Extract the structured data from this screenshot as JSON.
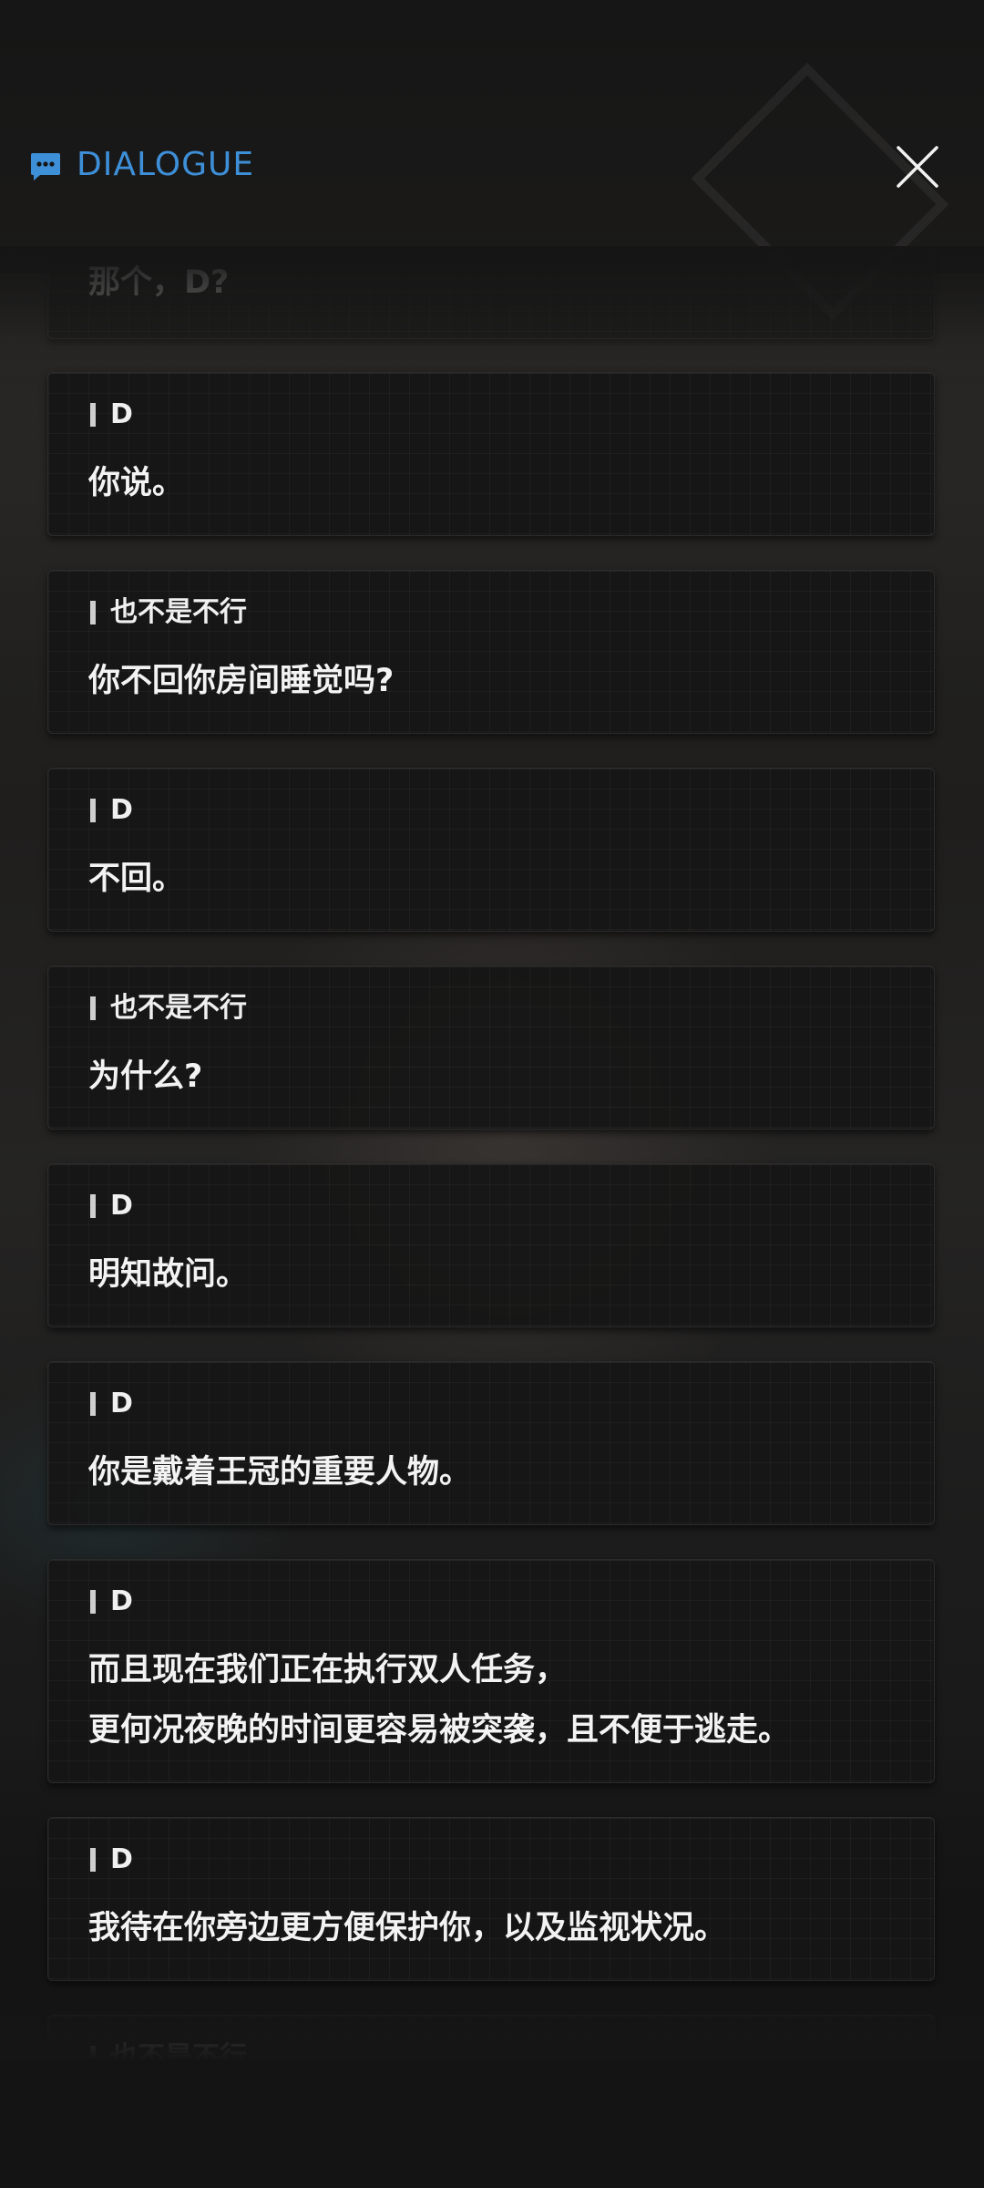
{
  "header": {
    "title": "DIALOGUE",
    "accent_color": "#3d8fd8",
    "icon": "chat-bubble-icon",
    "close_icon": "close-icon"
  },
  "dialogue": {
    "partial_top_line": "那个，D?",
    "cards": [
      {
        "speaker": "D",
        "lines": [
          "你说。"
        ]
      },
      {
        "speaker": "也不是不行",
        "lines": [
          "你不回你房间睡觉吗?"
        ]
      },
      {
        "speaker": "D",
        "lines": [
          "不回。"
        ]
      },
      {
        "speaker": "也不是不行",
        "lines": [
          "为什么?"
        ]
      },
      {
        "speaker": "D",
        "lines": [
          "明知故问。"
        ]
      },
      {
        "speaker": "D",
        "lines": [
          "你是戴着王冠的重要人物。"
        ]
      },
      {
        "speaker": "D",
        "lines": [
          "而且现在我们正在执行双人任务，",
          "更何况夜晚的时间更容易被突袭，且不便于逃走。"
        ]
      },
      {
        "speaker": "D",
        "lines": [
          "我待在你旁边更方便保护你，以及监视状况。"
        ]
      }
    ],
    "partial_bottom_speaker": "也不是不行"
  }
}
